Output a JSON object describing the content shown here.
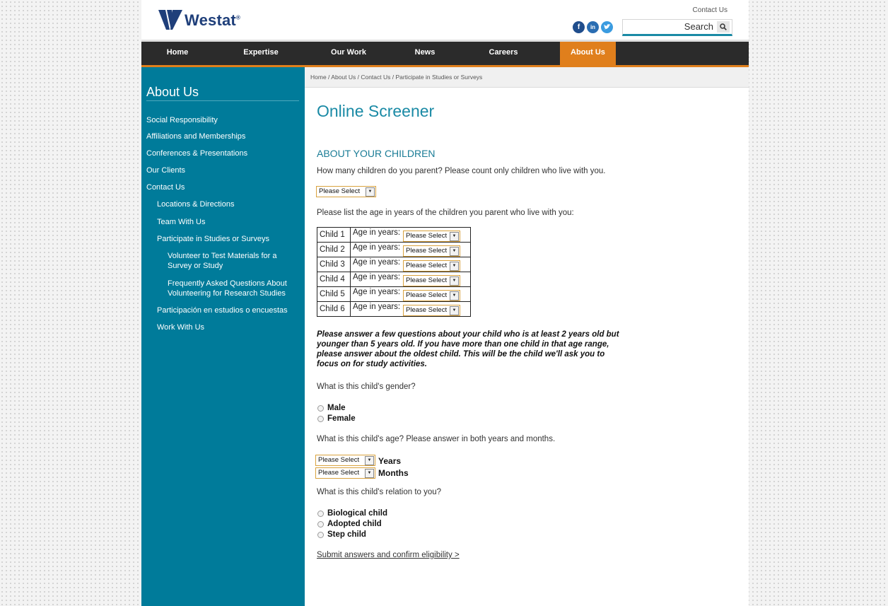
{
  "brand": {
    "name": "Westat",
    "mark": "®"
  },
  "header": {
    "contact_link": "Contact Us",
    "social": {
      "facebook": "f",
      "linkedin": "in",
      "twitter": "t"
    },
    "search_label": "Search"
  },
  "nav": {
    "items": [
      {
        "label": "Home"
      },
      {
        "label": "Expertise"
      },
      {
        "label": "Our Work"
      },
      {
        "label": "News"
      },
      {
        "label": "Careers"
      },
      {
        "label": "About Us"
      }
    ],
    "active_color": "#e07f1c"
  },
  "breadcrumb": "Home / About Us / Contact Us / Participate in Studies or Surveys",
  "sidebar": {
    "title": "About Us",
    "items": [
      {
        "label": "Social Responsibility"
      },
      {
        "label": "Affiliations and Memberships"
      },
      {
        "label": "Conferences & Presentations"
      },
      {
        "label": "Our Clients"
      },
      {
        "label": "Contact Us"
      },
      {
        "label": "Locations & Directions"
      },
      {
        "label": "Team With Us"
      },
      {
        "label": "Participate in Studies or Surveys"
      },
      {
        "label": "Volunteer to Test Materials for a Survey or Study"
      },
      {
        "label": "Frequently Asked Questions About Volunteering for Research Studies"
      },
      {
        "label": "Participación en estudios o encuestas"
      },
      {
        "label": "Work With Us"
      }
    ],
    "bg_color": "#007b9a"
  },
  "main": {
    "title": "Online Screener",
    "section_heading": "ABOUT YOUR CHILDREN",
    "q_count": "How many children do you parent? Please count only children who live with you.",
    "select_placeholder": "Please Select",
    "q_ages": "Please list the age in years of the children you parent who live with you:",
    "age_label": "Age in years:",
    "children": [
      {
        "label": "Child 1"
      },
      {
        "label": "Child 2"
      },
      {
        "label": "Child 3"
      },
      {
        "label": "Child 4"
      },
      {
        "label": "Child 5"
      },
      {
        "label": "Child 6"
      }
    ],
    "instruction": "Please answer a few questions about your child who is at least 2 years old but younger than 5 years old. If you have more than one child in that age range, please answer about the oldest child. This will be the child we'll ask you to focus on for study activities.",
    "q_gender": "What is this child's gender?",
    "gender_options": [
      "Male",
      "Female"
    ],
    "q_age": "What is this child's age? Please answer in both years and months.",
    "years_label": "Years",
    "months_label": "Months",
    "q_relation": "What is this child's relation to you?",
    "relation_options": [
      "Biological child",
      "Adopted child",
      "Step child"
    ],
    "submit": "Submit answers and confirm eligibility >"
  }
}
